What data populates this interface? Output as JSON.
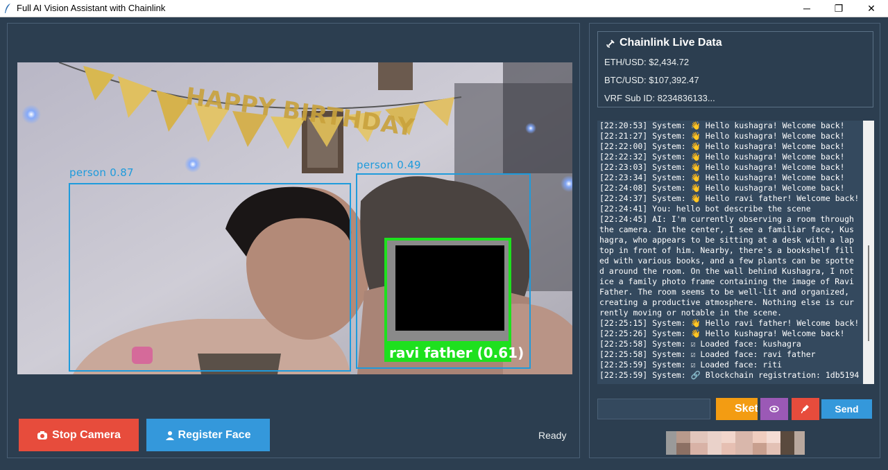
{
  "window": {
    "title": "Full AI Vision Assistant with Chainlink",
    "minimize_glyph": "─",
    "restore_glyph": "❐",
    "close_glyph": "✕"
  },
  "camera": {
    "detections": [
      {
        "label": "person 0.87"
      },
      {
        "label": "person 0.49"
      }
    ],
    "face": {
      "label": "ravi father (0.61)"
    },
    "banner_text": "HAPPY BIRTHDAY"
  },
  "controls": {
    "stop_camera_label": "Stop Camera",
    "register_face_label": "Register Face",
    "status": "Ready"
  },
  "chainlink": {
    "title": "Chainlink Live Data",
    "eth": "ETH/USD: $2,434.72",
    "btc": "BTC/USD: $107,392.47",
    "vrf": "VRF Sub ID: 8234836133..."
  },
  "log": [
    "[22:20:53] System: 👋 Hello kushagra! Welcome back!",
    "[22:21:27] System: 👋 Hello kushagra! Welcome back!",
    "[22:22:00] System: 👋 Hello kushagra! Welcome back!",
    "[22:22:32] System: 👋 Hello kushagra! Welcome back!",
    "[22:23:03] System: 👋 Hello kushagra! Welcome back!",
    "[22:23:34] System: 👋 Hello kushagra! Welcome back!",
    "[22:24:08] System: 👋 Hello kushagra! Welcome back!",
    "[22:24:37] System: 👋 Hello ravi father! Welcome back!",
    "[22:24:41] You: hello bot describe the scene",
    "[22:24:45] AI: I'm currently observing a room through",
    "the camera. In the center, I see a familiar face, Kus",
    "hagra, who appears to be sitting at a desk with a lap",
    "top in front of him. Nearby, there's a bookshelf fill",
    "ed with various books, and a few plants can be spotte",
    "d around the room. On the wall behind Kushagra, I not",
    "ice a family photo frame containing the image of Ravi",
    "Father. The room seems to be well-lit and organized,",
    "creating a productive atmosphere. Nothing else is cur",
    "rently moving or notable in the scene.",
    "[22:25:15] System: 👋 Hello ravi father! Welcome back!",
    "[22:25:26] System: 👋 Hello kushagra! Welcome back!",
    "[22:25:58] System: ☑ Loaded face: kushagra",
    "[22:25:58] System: ☑ Loaded face: ravi father",
    "[22:25:59] System: ☑ Loaded face: riti",
    "[22:25:59] System: 🔗 Blockchain registration: 1db5194"
  ],
  "chat": {
    "input_value": "",
    "sketch_label": "Sketch",
    "send_label": "Send"
  },
  "icons": {
    "app": "feather-icon",
    "stop": "camera-icon",
    "register": "user-icon",
    "chainlink": "satellite-icon",
    "eye": "eye-icon",
    "mic": "microphone-icon"
  },
  "colors": {
    "background": "#2c3e50",
    "stop": "#e74c3c",
    "register": "#3498db",
    "sketch": "#f39c12",
    "eye": "#9b59b6",
    "mic": "#e74c3c",
    "send": "#3498db",
    "detection_box": "#1e9bdc",
    "face_box": "#1ee01e"
  }
}
